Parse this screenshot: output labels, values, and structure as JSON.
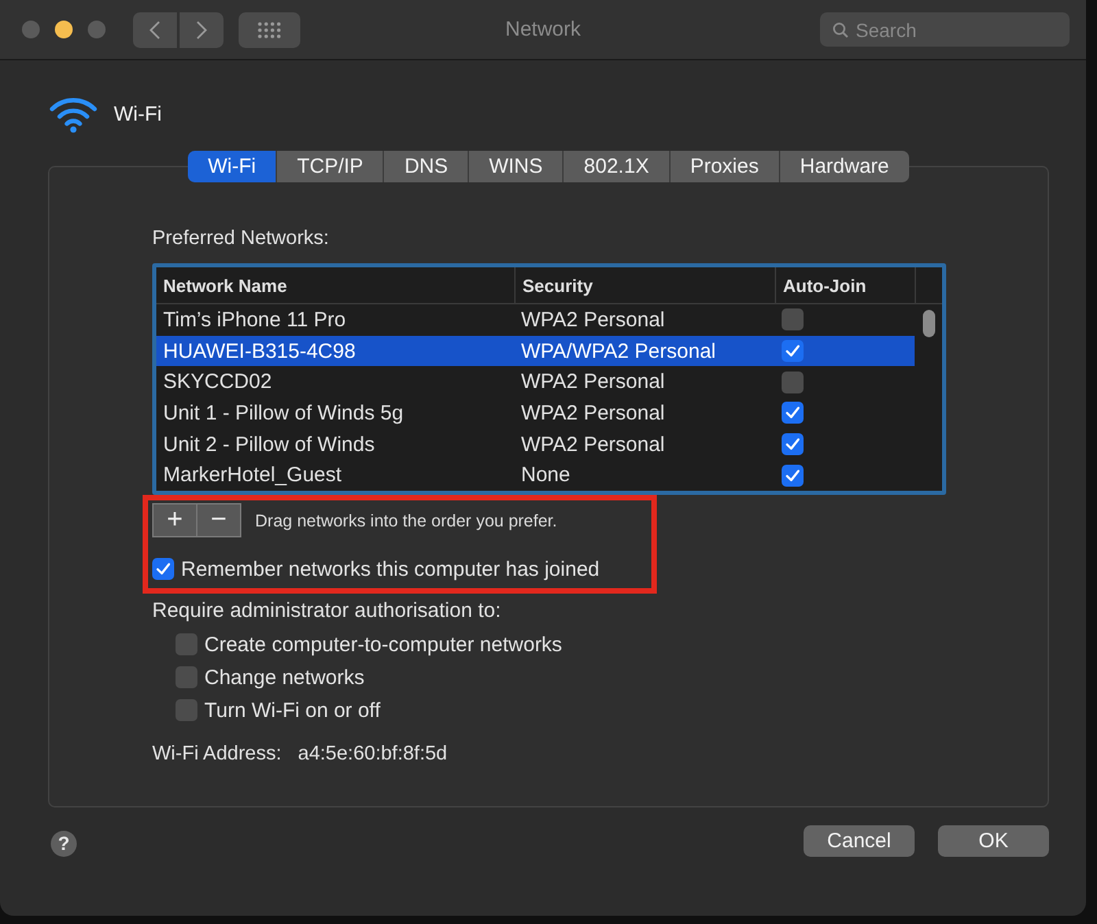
{
  "window": {
    "title": "Network",
    "traffic_lights": [
      {
        "color": "#5a5a5a"
      },
      {
        "color": "#f5bd4f"
      },
      {
        "color": "#5a5a5a"
      }
    ],
    "search": {
      "placeholder": "Search"
    }
  },
  "header": {
    "label": "Wi-Fi"
  },
  "tabs": [
    {
      "label": "Wi-Fi",
      "selected": true
    },
    {
      "label": "TCP/IP",
      "selected": false
    },
    {
      "label": "DNS",
      "selected": false
    },
    {
      "label": "WINS",
      "selected": false
    },
    {
      "label": "802.1X",
      "selected": false
    },
    {
      "label": "Proxies",
      "selected": false
    },
    {
      "label": "Hardware",
      "selected": false
    }
  ],
  "preferred_networks": {
    "label": "Preferred Networks:",
    "columns": [
      "Network Name",
      "Security",
      "Auto-Join"
    ],
    "rows": [
      {
        "name": "Tim’s iPhone 11 Pro",
        "security": "WPA2 Personal",
        "auto_join": false,
        "selected": false
      },
      {
        "name": "HUAWEI-B315-4C98",
        "security": "WPA/WPA2 Personal",
        "auto_join": true,
        "selected": true
      },
      {
        "name": "SKYCCD02",
        "security": "WPA2 Personal",
        "auto_join": false,
        "selected": false
      },
      {
        "name": "Unit 1 - Pillow of Winds 5g",
        "security": "WPA2 Personal",
        "auto_join": true,
        "selected": false
      },
      {
        "name": "Unit 2 - Pillow of Winds",
        "security": "WPA2 Personal",
        "auto_join": true,
        "selected": false
      },
      {
        "name": "MarkerHotel_Guest",
        "security": "None",
        "auto_join": true,
        "selected": false
      }
    ]
  },
  "list_controls": {
    "highlighted": true,
    "buttons": [
      "+",
      "−"
    ],
    "hint": "Drag networks into the order you prefer.",
    "remember": {
      "label": "Remember networks this computer has joined",
      "checked": true
    }
  },
  "admin": {
    "label": "Require administrator authorisation to:",
    "options": [
      {
        "label": "Create computer-to-computer networks",
        "checked": false
      },
      {
        "label": "Change networks",
        "checked": false
      },
      {
        "label": "Turn Wi-Fi on or off",
        "checked": false
      }
    ]
  },
  "address": {
    "label": "Wi-Fi Address:",
    "value": "a4:5e:60:bf:8f:5d"
  },
  "help": {
    "label": "?"
  },
  "buttons": [
    {
      "label": "Cancel"
    },
    {
      "label": "OK"
    }
  ]
}
